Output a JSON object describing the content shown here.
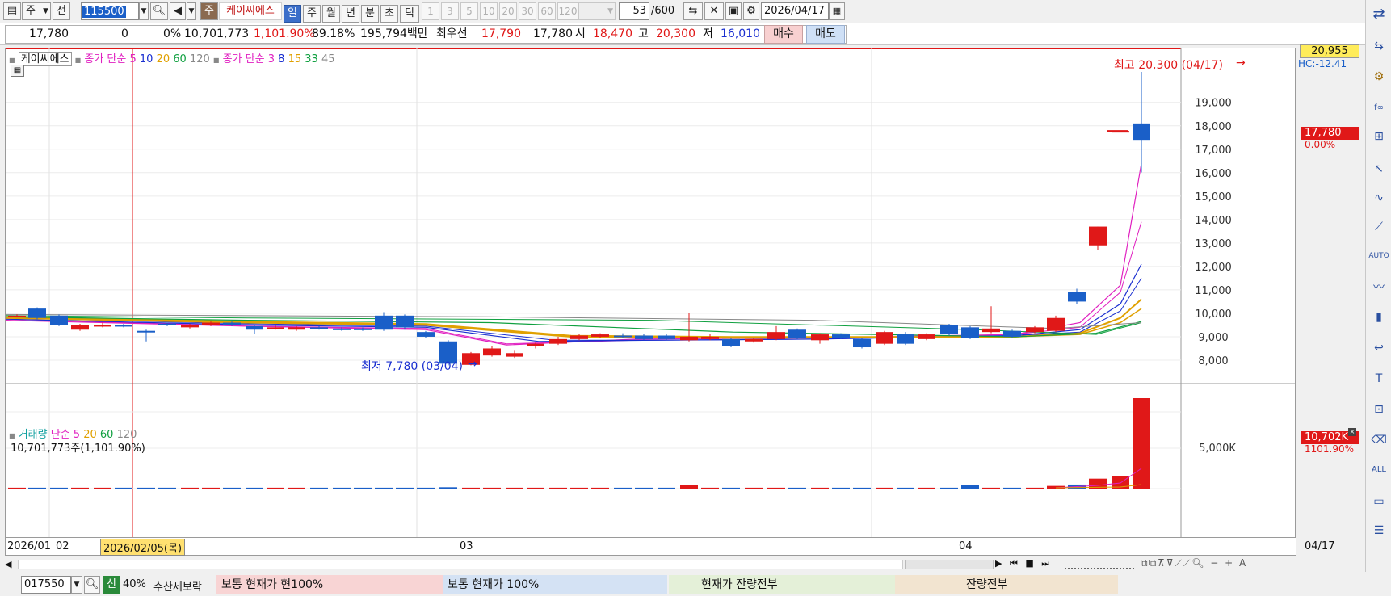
{
  "toolbar": {
    "btn_ju": "주",
    "btn_jeon": "전",
    "code": "115500",
    "btn_ju2": "주",
    "stock_name": "케이씨에스",
    "periods": [
      "일",
      "주",
      "월",
      "년",
      "분",
      "초",
      "틱"
    ],
    "period_selected": "일",
    "intervals": [
      "1",
      "3",
      "5",
      "10",
      "20",
      "30",
      "60",
      "120"
    ],
    "count": "53",
    "count_max": "/600",
    "date": "2026/04/17"
  },
  "quote": {
    "price": "17,780",
    "change": "0",
    "change_pct": "0%",
    "volume": "10,701,773",
    "volume_ratio": "1,101.90%",
    "turnover": "89.18%",
    "amount": "195,794백만",
    "best_label": "최우선",
    "best_ask": "17,790",
    "best_bid": "17,780",
    "open_label": "시",
    "open": "18,470",
    "high_label": "고",
    "high": "20,300",
    "low_label": "저",
    "low": "16,010",
    "buy": "매수",
    "sell": "매도"
  },
  "legend": {
    "price_name": "케이씨에스",
    "ma1_label": "종가 단순",
    "ma1_periods": [
      {
        "p": "5",
        "color": "#e020c0"
      },
      {
        "p": "10",
        "color": "#1a2fd0"
      },
      {
        "p": "20",
        "color": "#e0a000"
      },
      {
        "p": "60",
        "color": "#10a040"
      },
      {
        "p": "120",
        "color": "#888888"
      }
    ],
    "ma2_label": "종가 단순",
    "ma2_periods": [
      {
        "p": "3",
        "color": "#e020c0"
      },
      {
        "p": "8",
        "color": "#1a2fd0"
      },
      {
        "p": "15",
        "color": "#e0a000"
      },
      {
        "p": "33",
        "color": "#10a040"
      },
      {
        "p": "45",
        "color": "#888888"
      }
    ],
    "vol_name": "거래량",
    "vol_ma_label": "단순",
    "vol_periods": [
      {
        "p": "5",
        "color": "#e020c0"
      },
      {
        "p": "20",
        "color": "#e0a000"
      },
      {
        "p": "60",
        "color": "#10a040"
      },
      {
        "p": "120",
        "color": "#888888"
      }
    ],
    "vol_info": "10,701,773주(1,101.90%)"
  },
  "annotations": {
    "high": "최고 20,300 (04/17)",
    "low": "최저 7,780 (03/04)",
    "axis_top": "20,955",
    "hc": "HC:-12.41",
    "cur_price": "17,780",
    "cur_pct": "0.00%",
    "vol_box": "10,702K",
    "vol_pct": "1101.90%"
  },
  "price_axis": [
    "19,000",
    "18,000",
    "17,000",
    "16,000",
    "15,000",
    "14,000",
    "13,000",
    "12,000",
    "11,000",
    "10,000",
    "9,000",
    "8,000"
  ],
  "vol_axis": [
    "5,000K"
  ],
  "x_axis": {
    "left": "2026/01",
    "d02": "02",
    "cursor": "2026/02/05(목)",
    "d03": "03",
    "d04": "04",
    "right": "04/17"
  },
  "bottom": {
    "code": "017550",
    "badge": "신",
    "pct": "40%",
    "label1": "수산세보락",
    "seg1": "보통   현재가    현100%",
    "seg2": "보통   현재가      100%",
    "seg3": "현재가     잔량전부",
    "seg4": "잔량전부"
  },
  "colors": {
    "up": "#e01818",
    "down": "#1a5fc8",
    "grid": "#e6e6e6"
  }
}
